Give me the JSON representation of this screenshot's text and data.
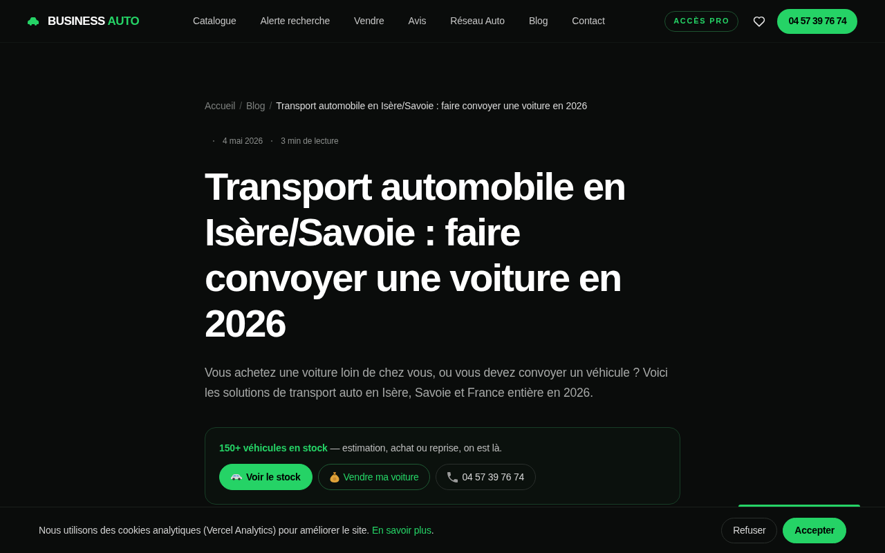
{
  "header": {
    "logo": {
      "text": "BUSINESS",
      "accent": "AUTO"
    },
    "nav": [
      {
        "label": "Catalogue"
      },
      {
        "label": "Alerte recherche"
      },
      {
        "label": "Vendre"
      },
      {
        "label": "Avis"
      },
      {
        "label": "Réseau Auto"
      },
      {
        "label": "Blog"
      },
      {
        "label": "Contact"
      }
    ],
    "pro_button": "ACCÈS PRO",
    "phone_button": "04 57 39 76 74"
  },
  "breadcrumb": {
    "separator": "/",
    "items": [
      {
        "label": "Accueil",
        "current": false
      },
      {
        "label": "Blog",
        "current": false
      },
      {
        "label": "Transport automobile en Isère/Savoie : faire convoyer une voiture en 2026",
        "current": true
      }
    ]
  },
  "meta": [
    "4 mai 2026",
    "3 min de lecture"
  ],
  "title": "Transport automobile en Isère/Savoie : faire convoyer une voiture en 2026",
  "lead": "Vous achetez une voiture loin de chez vous, ou vous devez convoyer un véhicule ? Voici les solutions de transport auto en Isère, Savoie et France entière en 2026.",
  "cta": {
    "text": "**150+ véhicules en stock** — estimation, achat ou reprise, on est là.",
    "buttons": [
      {
        "kind": "primary",
        "label": "Voir le stock"
      },
      {
        "kind": "outline",
        "label": "Vendre ma voiture"
      },
      {
        "kind": "ghost",
        "label": "04 57 39 76 74"
      }
    ]
  },
  "cookie_banner": {
    "text": "Nous utilisons des cookies analytiques (Vercel Analytics) pour améliorer le site.",
    "link": "En savoir plus",
    "after_link": ".",
    "buttons": [
      {
        "kind": "secondary",
        "label": "Refuser"
      },
      {
        "kind": "primary",
        "label": "Accepter"
      }
    ]
  }
}
